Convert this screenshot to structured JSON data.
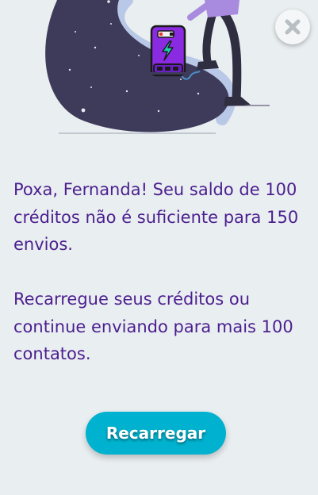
{
  "dialog": {
    "message_line_1": "Poxa, Fernanda! Seu saldo de 100 créditos não é suficiente para 150 envios.",
    "message_line_2": "Recarregue seus créditos ou continue enviando para mais 100 contatos.",
    "primary_button": "Recarregar",
    "close_icon": "close-icon"
  },
  "colors": {
    "text": "#4b1f8e",
    "button": "#00b2cf",
    "background": "#e9eef1"
  }
}
